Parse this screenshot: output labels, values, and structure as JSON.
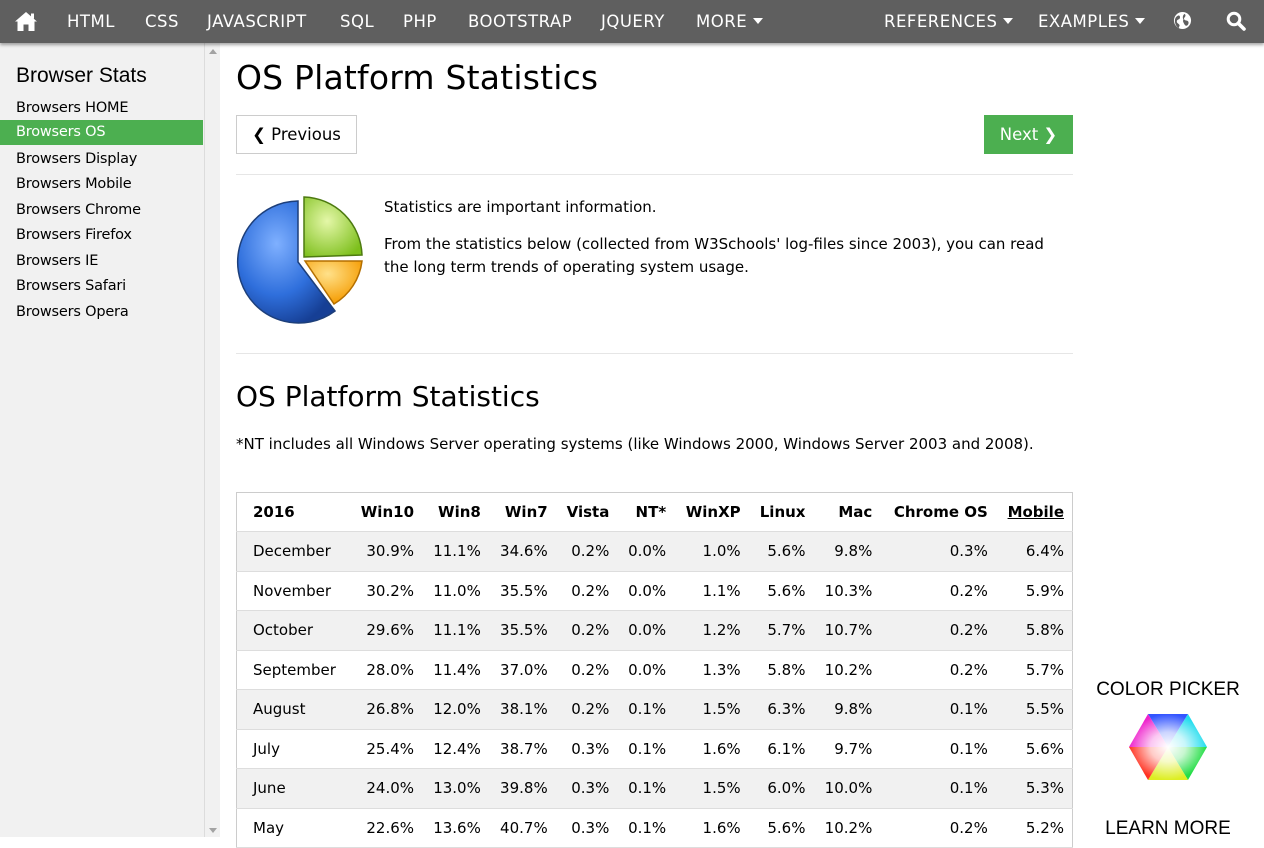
{
  "nav": {
    "items": [
      "HTML",
      "CSS",
      "JAVASCRIPT",
      "SQL",
      "PHP",
      "BOOTSTRAP",
      "JQUERY",
      "MORE"
    ],
    "references": "REFERENCES",
    "examples": "EXAMPLES",
    "bar_color": "#5f5f5f"
  },
  "sidebar": {
    "title": "Browser Stats",
    "items": [
      {
        "label": "Browsers HOME"
      },
      {
        "label": "Browsers OS",
        "active": true
      },
      {
        "label": "Browsers Display"
      },
      {
        "label": "Browsers Mobile"
      },
      {
        "label": "Browsers Chrome"
      },
      {
        "label": "Browsers Firefox"
      },
      {
        "label": "Browsers IE"
      },
      {
        "label": "Browsers Safari"
      },
      {
        "label": "Browsers Opera"
      }
    ],
    "active_color": "#4caf50"
  },
  "main": {
    "title": "OS Platform Statistics",
    "prev_label": "❮ Previous",
    "next_label": "Next ❯",
    "intro1": "Statistics are important information.",
    "intro2": "From the statistics below (collected from W3Schools' log-files since 2003), you can read the long term trends of operating system usage.",
    "section_title": "OS Platform Statistics",
    "note": "*NT includes all Windows Server operating systems (like Windows 2000, Windows Server 2003 and 2008)."
  },
  "table": {
    "headers": [
      "2016",
      "Win10",
      "Win8",
      "Win7",
      "Vista",
      "NT*",
      "WinXP",
      "Linux",
      "Mac",
      "Chrome OS",
      "Mobile"
    ],
    "rows": [
      [
        "December",
        "30.9%",
        "11.1%",
        "34.6%",
        "0.2%",
        "0.0%",
        "1.0%",
        "5.6%",
        "9.8%",
        "0.3%",
        "6.4%"
      ],
      [
        "November",
        "30.2%",
        "11.0%",
        "35.5%",
        "0.2%",
        "0.0%",
        "1.1%",
        "5.6%",
        "10.3%",
        "0.2%",
        "5.9%"
      ],
      [
        "October",
        "29.6%",
        "11.1%",
        "35.5%",
        "0.2%",
        "0.0%",
        "1.2%",
        "5.7%",
        "10.7%",
        "0.2%",
        "5.8%"
      ],
      [
        "September",
        "28.0%",
        "11.4%",
        "37.0%",
        "0.2%",
        "0.0%",
        "1.3%",
        "5.8%",
        "10.2%",
        "0.2%",
        "5.7%"
      ],
      [
        "August",
        "26.8%",
        "12.0%",
        "38.1%",
        "0.2%",
        "0.1%",
        "1.5%",
        "6.3%",
        "9.8%",
        "0.1%",
        "5.5%"
      ],
      [
        "July",
        "25.4%",
        "12.4%",
        "38.7%",
        "0.3%",
        "0.1%",
        "1.6%",
        "6.1%",
        "9.7%",
        "0.1%",
        "5.6%"
      ],
      [
        "June",
        "24.0%",
        "13.0%",
        "39.8%",
        "0.3%",
        "0.1%",
        "1.5%",
        "6.0%",
        "10.0%",
        "0.1%",
        "5.3%"
      ],
      [
        "May",
        "22.6%",
        "13.6%",
        "40.7%",
        "0.3%",
        "0.1%",
        "1.6%",
        "5.6%",
        "10.2%",
        "0.2%",
        "5.2%"
      ]
    ]
  },
  "ad": {
    "title": "COLOR PICKER",
    "learn_more": "LEARN MORE"
  },
  "icons": {
    "home": "home-icon",
    "globe": "globe-icon",
    "search": "search-icon",
    "pie": "pie-chart-icon",
    "color_picker": "color-hexagon-icon"
  }
}
